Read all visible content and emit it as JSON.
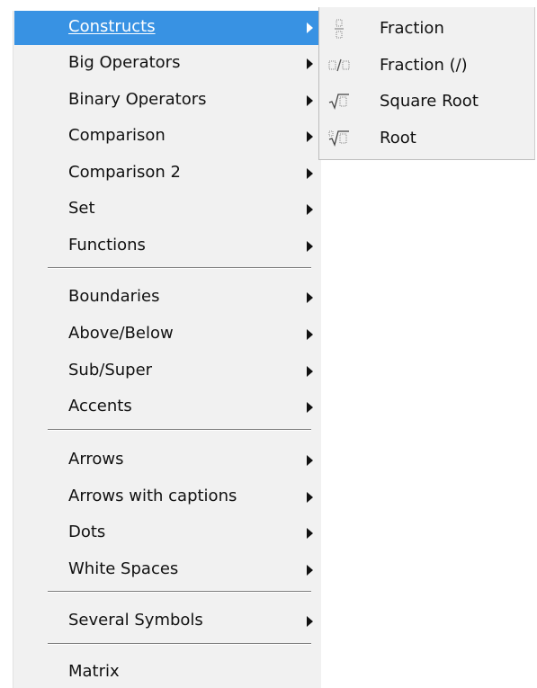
{
  "main_menu": {
    "items": [
      {
        "label": "Constructs",
        "submenu": true,
        "active": true
      },
      {
        "label": "Big Operators",
        "submenu": true
      },
      {
        "label": "Binary Operators",
        "submenu": true
      },
      {
        "label": "Comparison",
        "submenu": true
      },
      {
        "label": "Comparison 2",
        "submenu": true
      },
      {
        "label": "Set",
        "submenu": true
      },
      {
        "label": "Functions",
        "submenu": true
      },
      {
        "label": "Boundaries",
        "submenu": true
      },
      {
        "label": "Above/Below",
        "submenu": true
      },
      {
        "label": "Sub/Super",
        "submenu": true
      },
      {
        "label": "Accents",
        "submenu": true
      },
      {
        "label": "Arrows",
        "submenu": true
      },
      {
        "label": "Arrows with captions",
        "submenu": true
      },
      {
        "label": "Dots",
        "submenu": true
      },
      {
        "label": "White Spaces",
        "submenu": true
      },
      {
        "label": "Several Symbols",
        "submenu": true
      },
      {
        "label": "Matrix",
        "submenu": false
      }
    ]
  },
  "submenu": {
    "items": [
      {
        "label": "Fraction",
        "icon": "fraction-icon"
      },
      {
        "label": "Fraction (/)",
        "icon": "fraction-slash-icon"
      },
      {
        "label": "Square Root",
        "icon": "square-root-icon"
      },
      {
        "label": "Root",
        "icon": "nth-root-icon"
      }
    ]
  },
  "colors": {
    "menu_background": "#f1f1f1",
    "highlight": "#3892e3",
    "text": "#111111",
    "highlight_text": "#ffffff"
  }
}
